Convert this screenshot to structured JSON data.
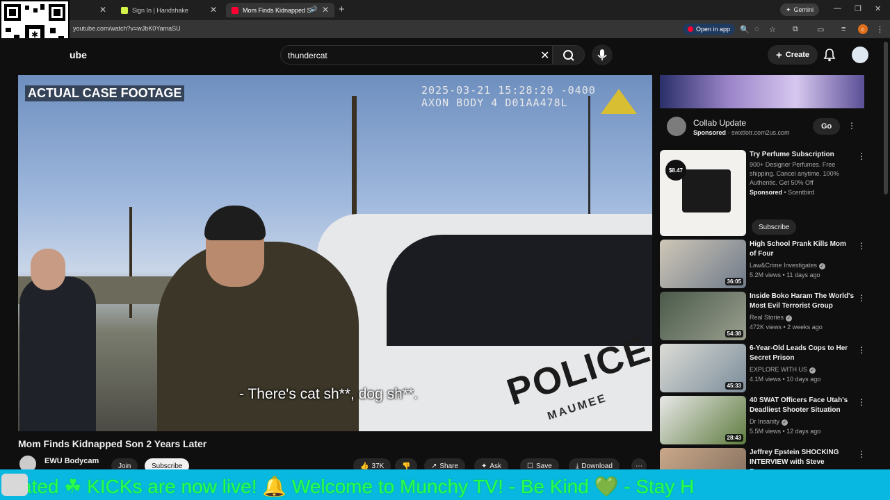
{
  "browser": {
    "tabs": [
      {
        "label": "",
        "active": false
      },
      {
        "label": "Sign In | Handshake",
        "active": false
      },
      {
        "label": "Mom Finds Kidnapped Son",
        "active": true
      }
    ],
    "gemini_label": "Gemini",
    "url": "youtube.com/watch?v=wJbK0YamaSU",
    "open_in_app": "Open in app"
  },
  "youtube": {
    "logo_text": "ube",
    "search_value": "thundercat",
    "create_label": "Create"
  },
  "video": {
    "overlay_label": "ACTUAL CASE FOOTAGE",
    "timestamp_line1": "2025-03-21 15:28:20 -0400",
    "timestamp_line2": "AXON BODY 4 D01AA478L",
    "subtitle": "- There's cat sh**, dog sh**.",
    "car_text": "POLICE",
    "car_subtext": "MAUMEE",
    "title": "Mom Finds Kidnapped Son 2 Years Later",
    "channel": "EWU Bodycam",
    "join": "Join",
    "subscribe": "Subscribe",
    "likes": "37K",
    "share": "Share",
    "ask": "Ask",
    "save": "Save",
    "download": "Download"
  },
  "ad_banner": {
    "title": "Collab Update",
    "sponsored": "Sponsored",
    "domain": "swxtlotr.com2us.com",
    "cta": "Go"
  },
  "ad_card": {
    "title": "Try Perfume Subscription",
    "desc": "900+ Designer Perfumes. Free shipping. Cancel anytime. 100% Authentic. Get 50% Off",
    "sponsored": "Sponsored",
    "advertiser": "Scentbird",
    "cta": "Subscribe",
    "price": "$8.47"
  },
  "recommendations": [
    {
      "title": "High School Prank Kills Mom of Four",
      "channel": "Law&Crime Investigates",
      "meta": "5.2M views • 11 days ago",
      "duration": "36:05",
      "verified": true
    },
    {
      "title": "Inside Boko Haram The World's Most Evil Terrorist Group",
      "channel": "Real Stories",
      "meta": "472K views • 2 weeks ago",
      "duration": "54:38",
      "verified": true
    },
    {
      "title": "6-Year-Old Leads Cops to Her Secret Prison",
      "channel": "EXPLORE WITH US",
      "meta": "4.1M views • 10 days ago",
      "duration": "45:33",
      "verified": true
    },
    {
      "title": "40 SWAT Officers Face Utah's Deadliest Shooter Situation",
      "channel": "Dr Insanity",
      "meta": "5.5M views • 12 days ago",
      "duration": "28:43",
      "verified": true
    },
    {
      "title": "Jeffrey Epstein SHOCKING INTERVIEW with Steve Bannon...",
      "channel": "",
      "meta": "",
      "duration": "",
      "verified": false
    }
  ],
  "ticker": {
    "text": "ated  ☘  KICKs are now live!  🔔        Welcome to Munchy TV!  - Be Kind  💚  - Stay H"
  },
  "colors": {
    "ticker_bg": "#08b8e0",
    "ticker_text": "#2cff4a",
    "yt_bg": "#0f0f0f"
  }
}
